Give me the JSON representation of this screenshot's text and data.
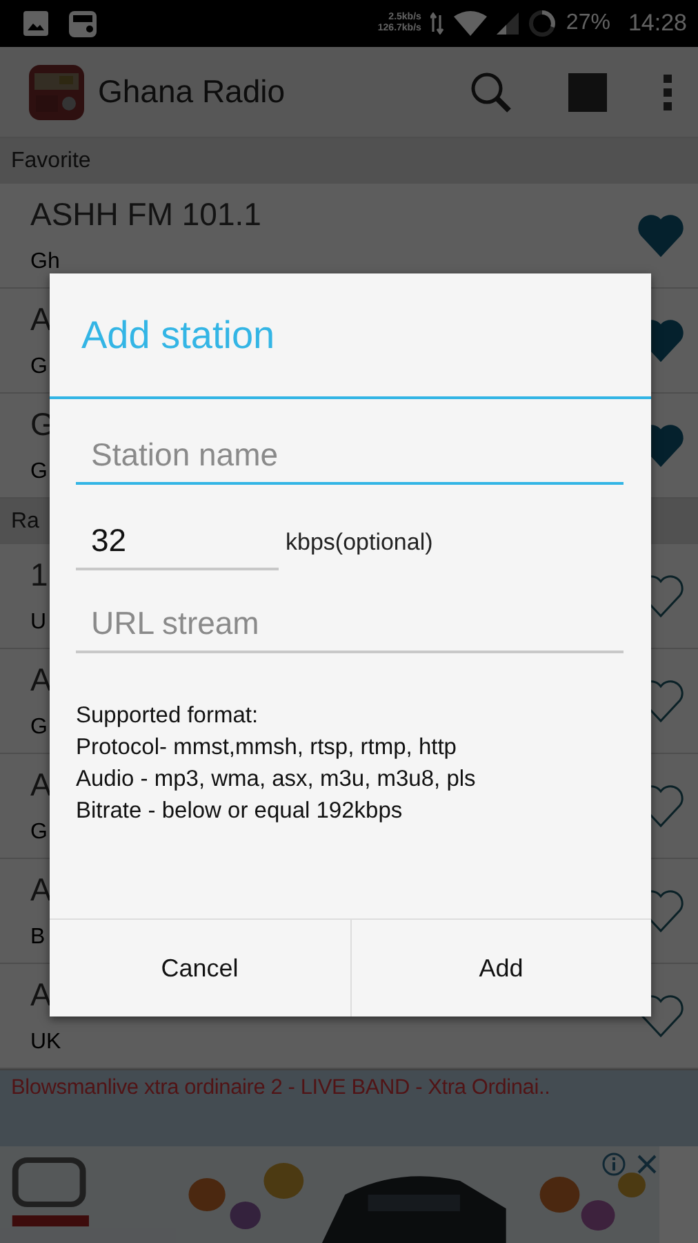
{
  "status_bar": {
    "net_up": "2.5kb/s",
    "net_down": "126.7kb/s",
    "battery": "27%",
    "time": "14:28"
  },
  "app_bar": {
    "title": "Ghana Radio"
  },
  "sections": [
    {
      "header": "Favorite",
      "rows": [
        {
          "name": "ASHH FM 101.1",
          "subtitle": "Gh",
          "favorite": true
        },
        {
          "name": "A",
          "subtitle": "G",
          "favorite": true
        },
        {
          "name": "G",
          "subtitle": "G",
          "favorite": true
        }
      ]
    },
    {
      "header": "Ra",
      "rows": [
        {
          "name": "1",
          "subtitle": "U",
          "favorite": false
        },
        {
          "name": "A",
          "subtitle": "G",
          "favorite": false
        },
        {
          "name": "A",
          "subtitle": "G",
          "favorite": false
        },
        {
          "name": "A",
          "subtitle": "B",
          "favorite": false
        },
        {
          "name": "A",
          "subtitle": "UK",
          "favorite": false
        }
      ]
    }
  ],
  "now_playing": "Blowsmanlive xtra ordinaire 2 - LIVE BAND - Xtra Ordinai..",
  "dialog": {
    "title": "Add station",
    "station_name": {
      "placeholder": "Station name",
      "focused": true
    },
    "bitrate": {
      "value": "32",
      "focused": false
    },
    "bitrate_label": "kbps(optional)",
    "url": {
      "placeholder": "URL stream",
      "focused": false
    },
    "format_lines": [
      "Supported format:",
      "Protocol- mmst,mmsh, rtsp, rtmp, http",
      "Audio - mp3, wma, asx, m3u, m3u8, pls",
      "Bitrate - below or equal 192kbps"
    ],
    "buttons": [
      "Cancel",
      "Add"
    ]
  }
}
